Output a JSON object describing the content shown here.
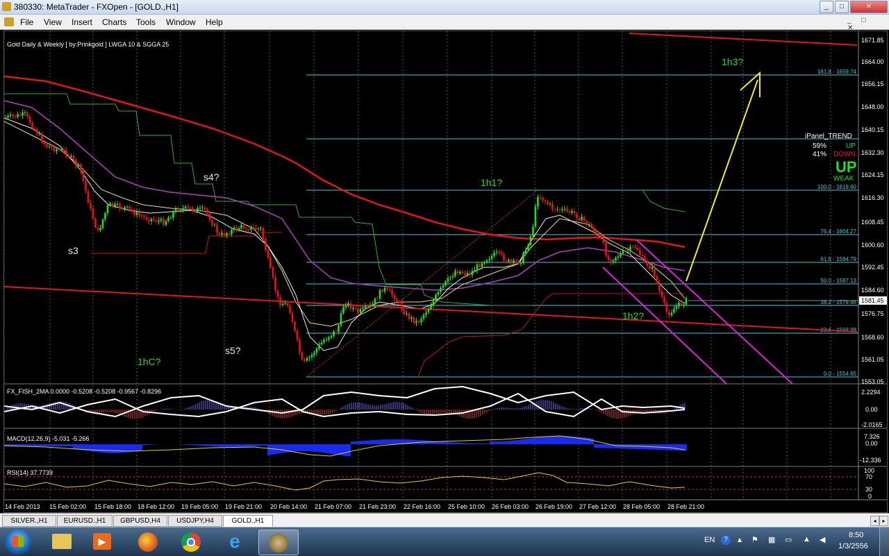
{
  "window": {
    "title": "380330: MetaTrader - FXOpen - [GOLD.,H1]"
  },
  "menu": [
    "File",
    "View",
    "Insert",
    "Charts",
    "Tools",
    "Window",
    "Help"
  ],
  "chart": {
    "header": "Gold Daily & Weekly [ by:Prinkgold ]  LWGA 10  &  SGGA 25",
    "price_axis": [
      "1671.85",
      "1664.00",
      "1656.15",
      "1648.00",
      "1640.15",
      "1632.30",
      "1624.15",
      "1616.30",
      "1608.45",
      "1600.60",
      "1592.45",
      "1584.60",
      "1576.75",
      "1568.60",
      "1561.05",
      "1553.05"
    ],
    "current_price": "1581.45",
    "fib_levels": [
      {
        "label": "161.8 - 1659.74"
      },
      {
        "label": "100.0 - 1619.60"
      },
      {
        "label": "76.4 - 1604.27"
      },
      {
        "label": "61.8 - 1594.79"
      },
      {
        "label": "50.0 - 1587.13"
      },
      {
        "label": "38.2 - 1579.46"
      },
      {
        "label": "23.6 - 1569.98"
      },
      {
        "label": "0.0 - 1554.65"
      }
    ],
    "annotations": [
      "s3",
      "s4?",
      "s5?",
      "1hC?",
      "1h1?",
      "1h2?",
      "1h3?"
    ],
    "ipanel": {
      "title": "iPanel_TREND",
      "up_pct": "59%",
      "up_label": "UP",
      "down_pct": "41%",
      "down_label": "DOWN",
      "big_label": "UP",
      "strength": "WEAK"
    },
    "time_axis": [
      "14 Feb 2013",
      "15 Feb 02:00",
      "15 Feb 18:00",
      "18 Feb 12:00",
      "19 Feb 05:00",
      "19 Feb 21:00",
      "20 Feb 14:00",
      "21 Feb 07:00",
      "21 Feb 23:00",
      "22 Feb 16:00",
      "25 Feb 10:00",
      "26 Feb 03:00",
      "26 Feb 19:00",
      "27 Feb 12:00",
      "28 Feb 05:00",
      "28 Feb 21:00"
    ]
  },
  "indicators": {
    "fisher": {
      "label": "FX_FISH_2MA 0.0000 -0.5208 -0.5208 -0.9567 -0.8296",
      "axis": [
        "2.2294",
        "0.00",
        "-2.0165"
      ]
    },
    "macd": {
      "label": "MACD(12,26,9) -5.031 -5.266",
      "axis": [
        "7.326",
        "0.00",
        "-12.336"
      ]
    },
    "rsi": {
      "label": "RSI(14) 37.7739",
      "axis": [
        "100",
        "70",
        "30",
        "0"
      ]
    }
  },
  "tabs": [
    {
      "label": "SILVER.,H1",
      "active": false
    },
    {
      "label": "EURUSD.,H1",
      "active": false
    },
    {
      "label": "GBPUSD,H4",
      "active": false
    },
    {
      "label": "USDJPY,H4",
      "active": false
    },
    {
      "label": "GOLD.,H1",
      "active": true
    }
  ],
  "taskbar": {
    "lang": "EN",
    "time": "8:50",
    "date": "1/3/2556"
  },
  "colors": {
    "bull": "#22dd22",
    "bear": "#ee1111",
    "fib": "#40c8d8",
    "trend_red": "#e01818",
    "channel": "#e020e0",
    "projection": "#f0f020",
    "annotation_green": "#22dd22"
  }
}
